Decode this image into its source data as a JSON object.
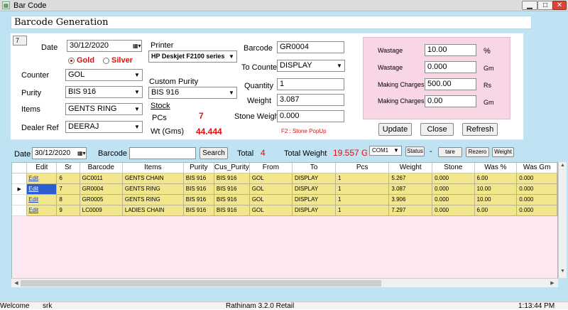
{
  "window": {
    "title": "Bar Code",
    "min": "▁",
    "max": "□",
    "close": "✕",
    "app_icon": "barcode-app-icon"
  },
  "header": {
    "title": "Barcode Generation"
  },
  "form": {
    "id_box": "7",
    "date_label": "Date",
    "date_value": "30/12/2020",
    "gold_label": "Gold",
    "silver_label": "Silver",
    "counter_label": "Counter",
    "counter_value": "GOL",
    "purity_label": "Purity",
    "purity_value": "BIS 916",
    "items_label": "Items",
    "items_value": "GENTS RING",
    "dealer_label": "Dealer Ref",
    "dealer_value": "DEERAJ",
    "printer_label": "Printer",
    "printer_value": "HP Deskjet F2100 series",
    "custom_purity_label": "Custom Purity",
    "custom_purity_value": "BIS 916",
    "stock_label": "Stock",
    "pcs_label": "PCs",
    "pcs_value": "7",
    "wt_label": "Wt (Gms)",
    "wt_value": "44.444",
    "barcode_label": "Barcode",
    "barcode_value": "GR0004",
    "to_counter_label": "To Counter",
    "to_counter_value": "DISPLAY",
    "quantity_label": "Quantity",
    "quantity_value": "1",
    "weight_label": "Weight",
    "weight_value": "3.087",
    "stone_weight_label": "Stone Weight",
    "stone_weight_value": "0.000",
    "hint": "F2 : Stone PopUp"
  },
  "charges": {
    "wastage1_label": "Wastage",
    "wastage1_value": "10.00",
    "wastage1_unit": "%",
    "wastage2_label": "Wastage",
    "wastage2_value": "0.000",
    "wastage2_unit": "Gm",
    "making1_label": "Making Charges",
    "making1_value": "500.00",
    "making1_unit": "Rs",
    "making2_label": "Making Charges",
    "making2_value": "0.00",
    "making2_unit": "Gm"
  },
  "actions": {
    "update": "Update",
    "close": "Close",
    "refresh": "Refresh"
  },
  "filter": {
    "date_label": "Date",
    "date_value": "30/12/2020",
    "barcode_label": "Barcode",
    "barcode_value": "",
    "search": "Search",
    "total_label": "Total",
    "total_value": "4",
    "total_weight_label": "Total Weight",
    "total_weight_value": "19.557 G",
    "port_value": "COM1",
    "status": "Status",
    "dash": "-",
    "tare": "tare",
    "rezero": "Rezero",
    "weight": "Weight"
  },
  "grid": {
    "columns": [
      "Edit",
      "Sr",
      "Barcode",
      "Items",
      "Purity",
      "Cus_Purity",
      "From",
      "To",
      "Pcs",
      "Weight",
      "Stone",
      "Was %",
      "Was Gm"
    ],
    "rows": [
      {
        "edit": "Edit",
        "sr": "6",
        "barcode": "GC0011",
        "items": "GENTS CHAIN",
        "purity": "BIS 916",
        "cus_purity": "BIS 916",
        "from": "GOL",
        "to": "DISPLAY",
        "pcs": "1",
        "weight": "5.267",
        "stone": "0.000",
        "was_pct": "6.00",
        "was_gm": "0.000"
      },
      {
        "edit": "Edit",
        "sr": "7",
        "barcode": "GR0004",
        "items": "GENTS RING",
        "purity": "BIS 916",
        "cus_purity": "BIS 916",
        "from": "GOL",
        "to": "DISPLAY",
        "pcs": "1",
        "weight": "3.087",
        "stone": "0.000",
        "was_pct": "10.00",
        "was_gm": "0.000"
      },
      {
        "edit": "Edit",
        "sr": "8",
        "barcode": "GR0005",
        "items": "GENTS RING",
        "purity": "BIS 916",
        "cus_purity": "BIS 916",
        "from": "GOL",
        "to": "DISPLAY",
        "pcs": "1",
        "weight": "3.906",
        "stone": "0.000",
        "was_pct": "10.00",
        "was_gm": "0.000"
      },
      {
        "edit": "Edit",
        "sr": "9",
        "barcode": "LC0009",
        "items": "LADIES CHAIN",
        "purity": "BIS 916",
        "cus_purity": "BIS 916",
        "from": "GOL",
        "to": "DISPLAY",
        "pcs": "1",
        "weight": "7.297",
        "stone": "0.000",
        "was_pct": "6.00",
        "was_gm": "0.000"
      }
    ],
    "current_row_marker": "▶"
  },
  "statusbar": {
    "welcome": "Welcome",
    "user": "srk",
    "product": "Rathinam 3.2.0 Retail",
    "time": "1:13:44 PM"
  },
  "colors": {
    "client_bg": "#bfe3f3",
    "pink_panel": "#f8d6e6",
    "grid_row": "#f2e78d",
    "grid_bg": "#fde8f1",
    "accent_red": "#e01010",
    "selection": "#2b5ed1"
  }
}
